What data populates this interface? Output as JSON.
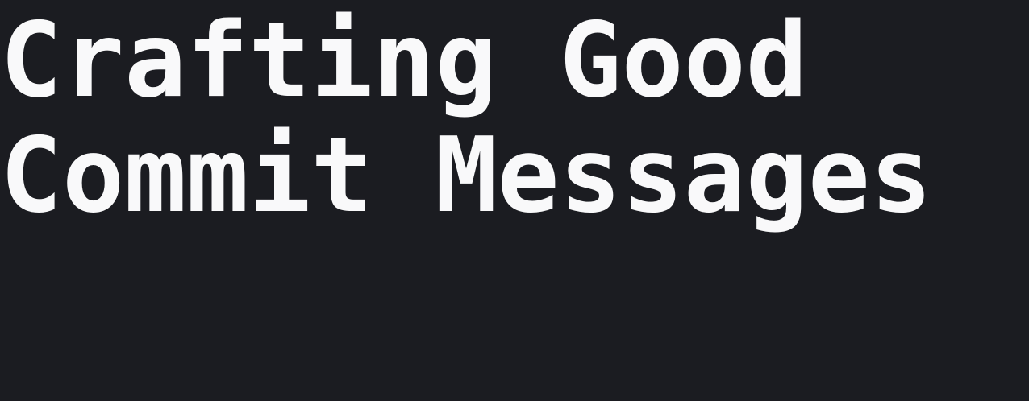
{
  "slide": {
    "title_lines": [
      "Crafting Good",
      "Commit Messages"
    ],
    "background_color": "#1b1c21",
    "text_color": "#f9f9fa"
  }
}
